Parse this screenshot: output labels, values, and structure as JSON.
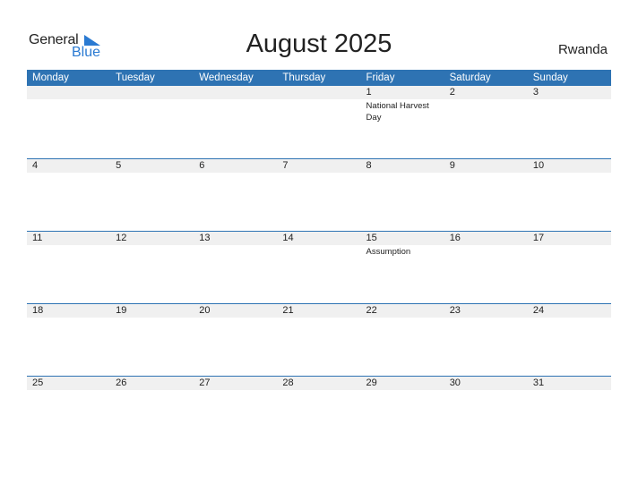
{
  "logo": {
    "general": "General",
    "blue": "Blue"
  },
  "title": "August 2025",
  "country": "Rwanda",
  "weekdays": [
    "Monday",
    "Tuesday",
    "Wednesday",
    "Thursday",
    "Friday",
    "Saturday",
    "Sunday"
  ],
  "weeks": [
    [
      {
        "day": "",
        "event": ""
      },
      {
        "day": "",
        "event": ""
      },
      {
        "day": "",
        "event": ""
      },
      {
        "day": "",
        "event": ""
      },
      {
        "day": "1",
        "event": "National Harvest Day"
      },
      {
        "day": "2",
        "event": ""
      },
      {
        "day": "3",
        "event": ""
      }
    ],
    [
      {
        "day": "4",
        "event": ""
      },
      {
        "day": "5",
        "event": ""
      },
      {
        "day": "6",
        "event": ""
      },
      {
        "day": "7",
        "event": ""
      },
      {
        "day": "8",
        "event": ""
      },
      {
        "day": "9",
        "event": ""
      },
      {
        "day": "10",
        "event": ""
      }
    ],
    [
      {
        "day": "11",
        "event": ""
      },
      {
        "day": "12",
        "event": ""
      },
      {
        "day": "13",
        "event": ""
      },
      {
        "day": "14",
        "event": ""
      },
      {
        "day": "15",
        "event": "Assumption"
      },
      {
        "day": "16",
        "event": ""
      },
      {
        "day": "17",
        "event": ""
      }
    ],
    [
      {
        "day": "18",
        "event": ""
      },
      {
        "day": "19",
        "event": ""
      },
      {
        "day": "20",
        "event": ""
      },
      {
        "day": "21",
        "event": ""
      },
      {
        "day": "22",
        "event": ""
      },
      {
        "day": "23",
        "event": ""
      },
      {
        "day": "24",
        "event": ""
      }
    ],
    [
      {
        "day": "25",
        "event": ""
      },
      {
        "day": "26",
        "event": ""
      },
      {
        "day": "27",
        "event": ""
      },
      {
        "day": "28",
        "event": ""
      },
      {
        "day": "29",
        "event": ""
      },
      {
        "day": "30",
        "event": ""
      },
      {
        "day": "31",
        "event": ""
      }
    ]
  ],
  "colors": {
    "header": "#2e73b3",
    "brand_blue": "#2a7ad2",
    "day_bar": "#f0f0f0"
  }
}
